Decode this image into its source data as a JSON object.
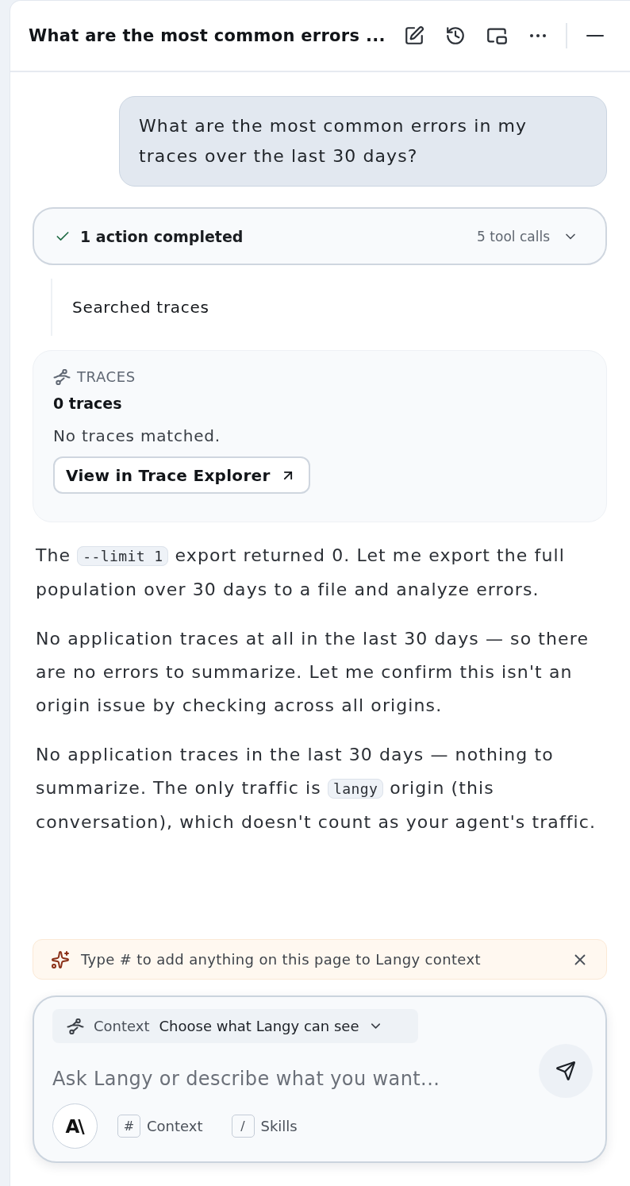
{
  "header": {
    "title": "What are the most common errors ..."
  },
  "user_message": {
    "text": "What are the most common errors in my traces over the last 30 days?"
  },
  "action_summary": {
    "label": "1 action completed",
    "tool_calls": "5 tool calls"
  },
  "steps": [
    {
      "label": "Searched traces"
    }
  ],
  "result_card": {
    "heading": "TRACES",
    "count": "0 traces",
    "message": "No traces matched.",
    "link": "View in Trace Explorer"
  },
  "paragraphs": [
    [
      {
        "kind": "text",
        "text": "The "
      },
      {
        "kind": "code",
        "text": "--limit 1"
      },
      {
        "kind": "text",
        "text": " export returned 0. Let me export the full population over 30 days to a file and analyze errors."
      }
    ],
    [
      {
        "kind": "text",
        "text": "No application traces at all in the last 30 days — so there are no errors to summarize. Let me confirm this isn't an origin issue by checking across all origins."
      }
    ],
    [
      {
        "kind": "text",
        "text": "No application traces in the last 30 days — nothing to summarize. The only traffic is "
      },
      {
        "kind": "code",
        "text": "langy"
      },
      {
        "kind": "text",
        "text": " origin (this conversation), which doesn't count as your agent's traffic."
      }
    ]
  ],
  "hint": {
    "text": "Type # to add anything on this page to Langy context"
  },
  "composer": {
    "context": {
      "label": "Context",
      "value": "Choose what Langy can see"
    },
    "placeholder": "Ask Langy or describe what you want...",
    "logo": "A\\",
    "shortcuts": [
      {
        "key": "#",
        "label": "Context"
      },
      {
        "key": "/",
        "label": "Skills"
      }
    ]
  }
}
